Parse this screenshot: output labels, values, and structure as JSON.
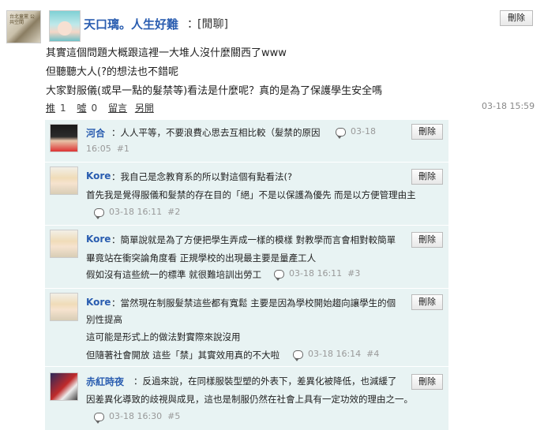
{
  "post": {
    "avatar_text": "台北童黨 公共空間",
    "author": "天口璃。人生好難",
    "separator": "：",
    "category": "[閒聊]",
    "delete_label": "刪除",
    "lines": [
      "其實這個問題大概跟這裡一大堆人沒什麼關西了www",
      "但聽聽大人(?的想法也不錯呢",
      "大家對服儀(或早一點的髮禁等)看法是什麼呢？真的是為了保護學生安全嗎"
    ],
    "actions": {
      "push_label": "推",
      "push_count": "1",
      "boo_label": "噓",
      "boo_count": "0",
      "reply_label": "留言",
      "hide_label": "另開"
    },
    "time": "03-18 15:59"
  },
  "replies": [
    {
      "name": "河合",
      "text_lines": [
        "：人人平等，不要浪費心思去互相比較（髮禁的原因"
      ],
      "time": "03-18",
      "time2": "16:05",
      "floor": "#1",
      "delete_label": "刪除",
      "avatar": "dark-hair-avatar"
    },
    {
      "name": "Kore",
      "text_lines": [
        "：我自己是念教育系的所以對這個有點看法(?",
        "首先我是覺得服儀和髮禁的存在目的「絕」不是以保護為優先 而是以方便管理由主"
      ],
      "time": "03-18 16:11",
      "floor": "#2",
      "delete_label": "刪除",
      "avatar": "kore-avatar"
    },
    {
      "name": "Kore",
      "text_lines": [
        "：簡單說就是為了方便把學生弄成一樣的模樣 對教學而言會相對較簡單",
        "畢竟站在衝突論角度看 正規學校的出現最主要是量產工人",
        "假如沒有這些統一的標準 就很難培訓出勞工"
      ],
      "time": "03-18 16:11",
      "floor": "#3",
      "delete_label": "刪除",
      "avatar": "kore-avatar"
    },
    {
      "name": "Kore",
      "text_lines": [
        "：當然現在制服髮禁這些都有寬鬆 主要是因為學校開始趨向讓學生的個",
        "別性提高",
        "這可能是形式上的做法對實際來說沒用",
        "但隨著社會開放 這些「禁」其實效用真的不大啦"
      ],
      "time": "03-18 16:14",
      "floor": "#4",
      "delete_label": "刪除",
      "avatar": "kore-avatar"
    },
    {
      "name": "赤紅時夜",
      "text_lines": [
        "：反過來說，在同樣服裝型塑的外表下，差異化被降低，也減緩了",
        "因差異化導致的歧視與成見，這也是制服仍然在社會上具有一定功效的理由之一。"
      ],
      "time": "03-18 16:30",
      "floor": "#5",
      "delete_label": "刪除",
      "avatar": "red-hair-avatar"
    }
  ]
}
